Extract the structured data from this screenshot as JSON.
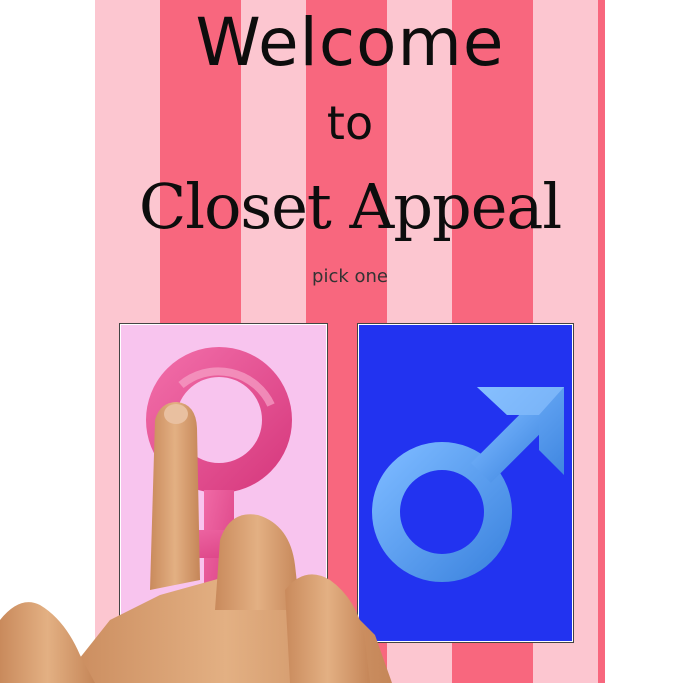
{
  "welcome": {
    "line1": "Welcome",
    "line2": "to",
    "line3": "Closet Appeal"
  },
  "subtitle": "pick one",
  "choices": [
    {
      "id": "female",
      "icon": "female-symbol-icon",
      "color": "#e8508f",
      "background": "#f8c4ee"
    },
    {
      "id": "male",
      "icon": "male-symbol-icon",
      "color": "#5aa5f5",
      "background": "#2233f0"
    }
  ],
  "colors": {
    "stripe_light": "#fcc6d0",
    "stripe_dark": "#f8677e",
    "title_text": "#0d0d0d"
  }
}
